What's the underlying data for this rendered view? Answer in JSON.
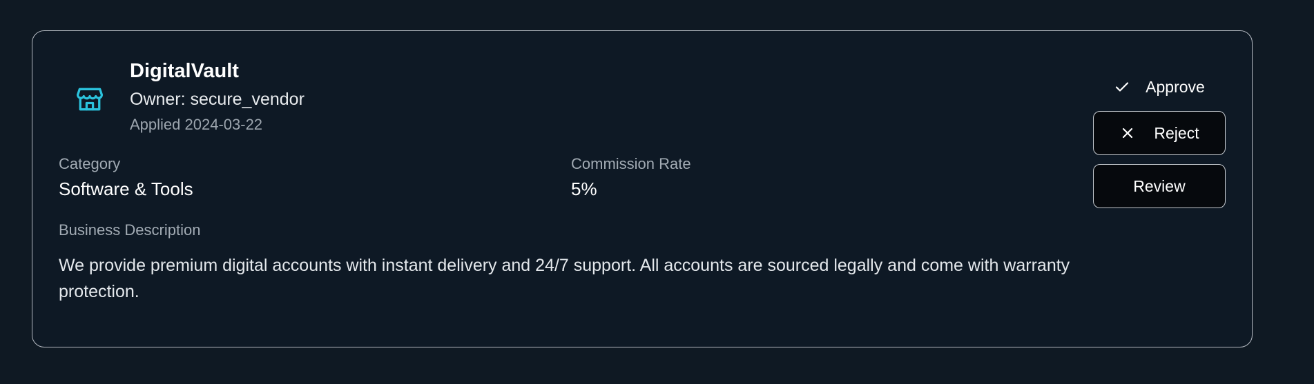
{
  "vendor": {
    "name": "DigitalVault",
    "owner": "Owner: secure_vendor",
    "applied": "Applied 2024-03-22",
    "icon": "store-icon",
    "accent_color": "#2bc3dd"
  },
  "details": {
    "category_label": "Category",
    "category_value": "Software & Tools",
    "commission_label": "Commission Rate",
    "commission_value": "5%",
    "description_label": "Business Description",
    "description_text": "We provide premium digital accounts with instant delivery and 24/7 support. All accounts are sourced legally and come with warranty protection."
  },
  "actions": {
    "approve_label": "Approve",
    "reject_label": "Reject",
    "review_label": "Review",
    "approve_icon": "check-icon",
    "reject_icon": "x-icon"
  }
}
